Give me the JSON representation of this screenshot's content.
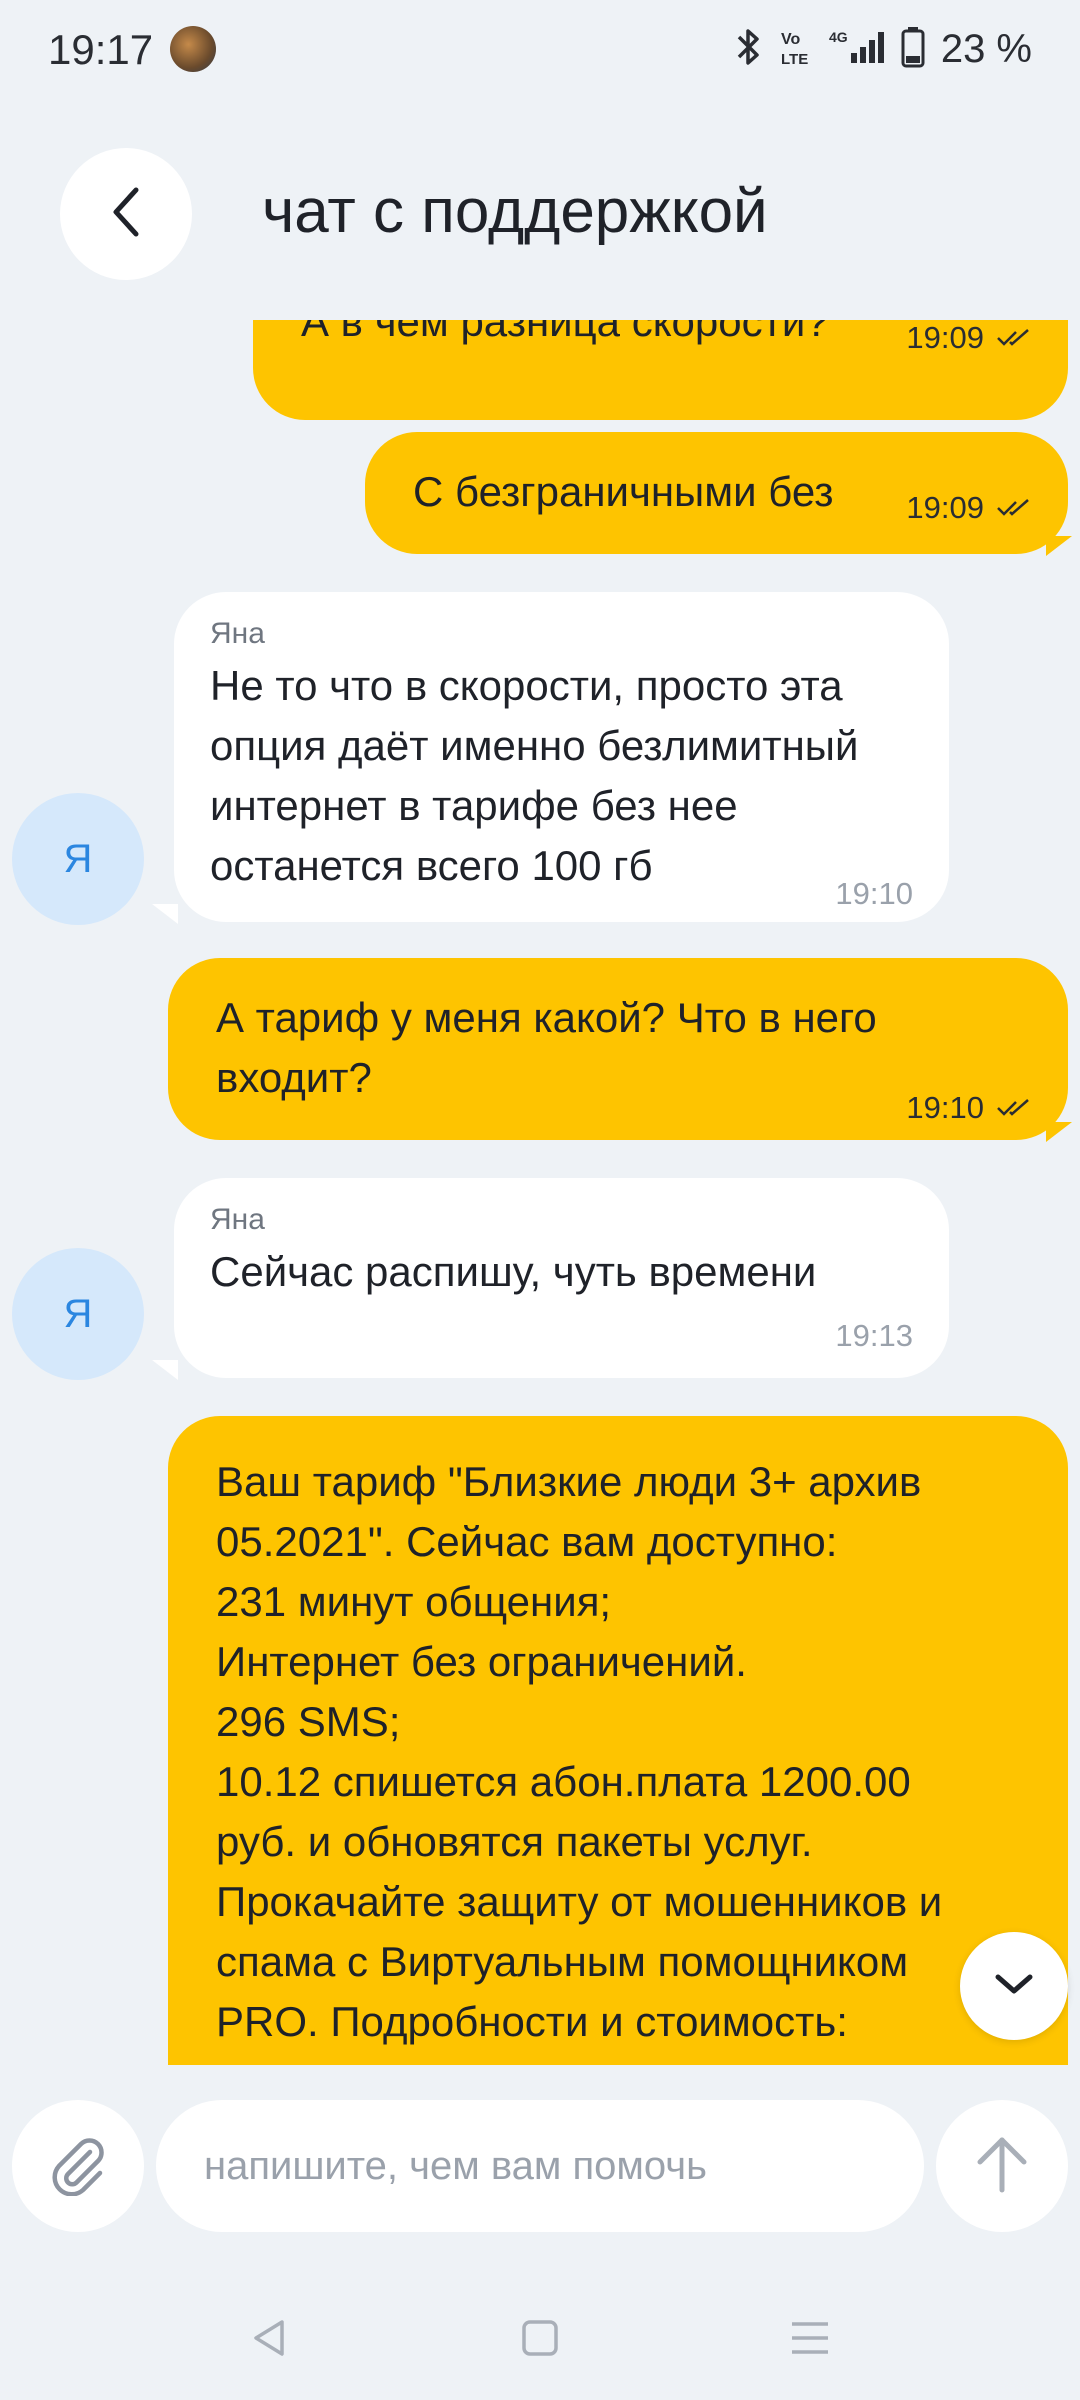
{
  "status_bar": {
    "time": "19:17",
    "battery_percent": "23 %",
    "icons": [
      "avatar-icon",
      "bluetooth-icon",
      "volte-icon",
      "4g-icon",
      "signal-icon",
      "battery-icon"
    ]
  },
  "header": {
    "title": "чат с поддержкой",
    "back_icon": "chevron-left-icon"
  },
  "messages": [
    {
      "direction": "out",
      "text": "А в чем разница скорости?",
      "time": "19:09",
      "status_icon": "double-check-icon"
    },
    {
      "direction": "out",
      "text": "С безграничными без",
      "time": "19:09",
      "status_icon": "double-check-icon"
    },
    {
      "direction": "in",
      "sender": "Яна",
      "avatar": "Я",
      "text": "Не то что в скорости, просто эта опция даёт именно безлимитный интернет в тарифе без нее останется всего 100 гб",
      "time": "19:10"
    },
    {
      "direction": "out",
      "text": "А тариф у меня какой? Что в него входит?",
      "time": "19:10",
      "status_icon": "double-check-icon"
    },
    {
      "direction": "in",
      "sender": "Яна",
      "avatar": "Я",
      "text": "Сейчас распишу, чуть времени",
      "time": "19:13"
    },
    {
      "direction": "out",
      "lines": [
        "Ваш тариф \"Близкие люди 3+ архив",
        "05.2021\". Сейчас вам доступно:",
        "231 минут общения;",
        "Интернет без ограничений.",
        "296 SMS;",
        "10.12 спишется абон.плата 1200.00",
        "руб. и обновятся пакеты услуг.",
        "Прокачайте защиту от мошенников и",
        "спама с Виртуальным помощником",
        "PRO. Подробности и стоимость:"
      ]
    }
  ],
  "composer": {
    "placeholder": "напишите, чем вам помочь",
    "attach_icon": "paperclip-icon",
    "send_icon": "arrow-up-icon"
  },
  "scroll_down_icon": "chevron-down-icon",
  "colors": {
    "background": "#eef2f6",
    "outgoing_bubble": "#fec400",
    "incoming_bubble": "#ffffff",
    "avatar_bg": "#d5e8fb",
    "avatar_text": "#2b86e0"
  }
}
